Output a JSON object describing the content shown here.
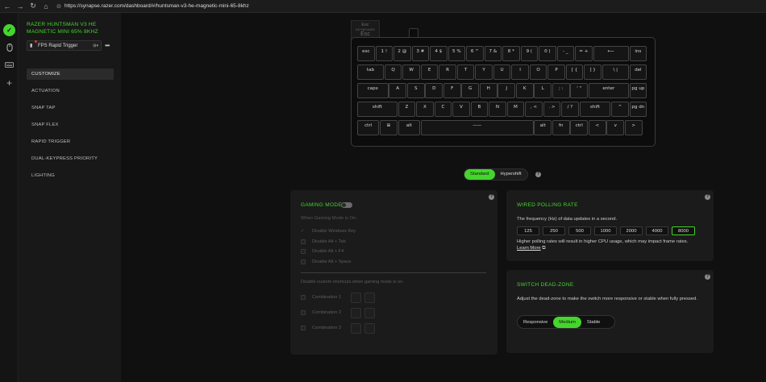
{
  "browser": {
    "back": "←",
    "forward": "→",
    "refresh": "↻",
    "home": "⌂",
    "url": "https://synapse.razer.com/dashboard/#/huntsman-v3-he-magnetic-mini-65-8khz"
  },
  "sidebar": {
    "device_name": "RAZER HUNTSMAN V3 HE MAGNETIC MINI 65% 8KHZ",
    "profile": "FPS Rapid Trigger",
    "more": "•••",
    "items": [
      {
        "label": "CUSTOMIZE",
        "active": true
      },
      {
        "label": "ACTUATION"
      },
      {
        "label": "SNAP TAP"
      },
      {
        "label": "SNAP FLEX"
      },
      {
        "label": "RAPID TRIGGER"
      },
      {
        "label": "DUAL-KEYPRESS PRIORITY"
      },
      {
        "label": "LIGHTING"
      }
    ]
  },
  "iconbar": {
    "items": [
      "razer-logo",
      "mouse-icon",
      "keyboard-icon",
      "add-icon"
    ]
  },
  "keyboard_legend": {
    "line1": "Esc",
    "line2": "KEYBOARD",
    "line3": "Esc"
  },
  "keyboard": {
    "rows": [
      [
        "esc",
        "1 !",
        "2 @",
        "3 #",
        "4 $",
        "5 %",
        "6 ^",
        "7 &",
        "8 *",
        "9 (",
        "0 )",
        "- _",
        "= +",
        "⟵",
        "ins"
      ],
      [
        "tab",
        "Q",
        "W",
        "E",
        "R",
        "T",
        "Y",
        "U",
        "I",
        "O",
        "P",
        "[ {",
        "] }",
        "\\ |",
        "del"
      ],
      [
        "capx",
        "A",
        "S",
        "D",
        "F",
        "G",
        "H",
        "J",
        "K",
        "L",
        "; :",
        "' \"",
        "enter",
        "pg up"
      ],
      [
        "shift",
        "Z",
        "X",
        "C",
        "V",
        "B",
        "N",
        "M",
        ", <",
        ". >",
        "/ ?",
        "shift",
        "^",
        "pg dn"
      ],
      [
        "ctrl",
        "⊞",
        "alt",
        "——",
        "alt",
        "fn",
        "ctrl",
        "<",
        "v",
        ">"
      ]
    ]
  },
  "mode_toggle": {
    "standard": "Standard",
    "hypershift": "Hypershift",
    "help": "?"
  },
  "gaming_mode": {
    "title": "GAMING MODE",
    "enabled": false,
    "when_on": "When Gaming Mode is On:",
    "options": [
      {
        "label": "Disable Windows Key",
        "checked": true
      },
      {
        "label": "Disable Alt + Tab",
        "checked": false
      },
      {
        "label": "Disable Alt + F4",
        "checked": false
      },
      {
        "label": "Disable Alt + Space",
        "checked": false
      }
    ],
    "custom_note": "Disable custom shortcuts when gaming mode is on.",
    "combinations": [
      "Combination 1",
      "Combination 2",
      "Combination 3"
    ]
  },
  "polling": {
    "title": "WIRED POLLING RATE",
    "desc": "The frequency (Hz) of data updates in a second.",
    "rates": [
      "125",
      "250",
      "500",
      "1000",
      "2000",
      "4000",
      "8000"
    ],
    "selected": "8000",
    "note": "Higher polling rates will result in higher CPU usage, which may impact frame rates.",
    "learn_more": "Learn More"
  },
  "deadzone": {
    "title": "SWITCH DEAD-ZONE",
    "desc": "Adjust the dead-zone to make the switch more responsive or stable when fully pressed.",
    "options": [
      "Responsive",
      "Medium",
      "Stable"
    ],
    "selected": "Medium"
  },
  "colors": {
    "accent": "#44d62c",
    "background": "#101010",
    "panel": "#1b1b1b"
  }
}
